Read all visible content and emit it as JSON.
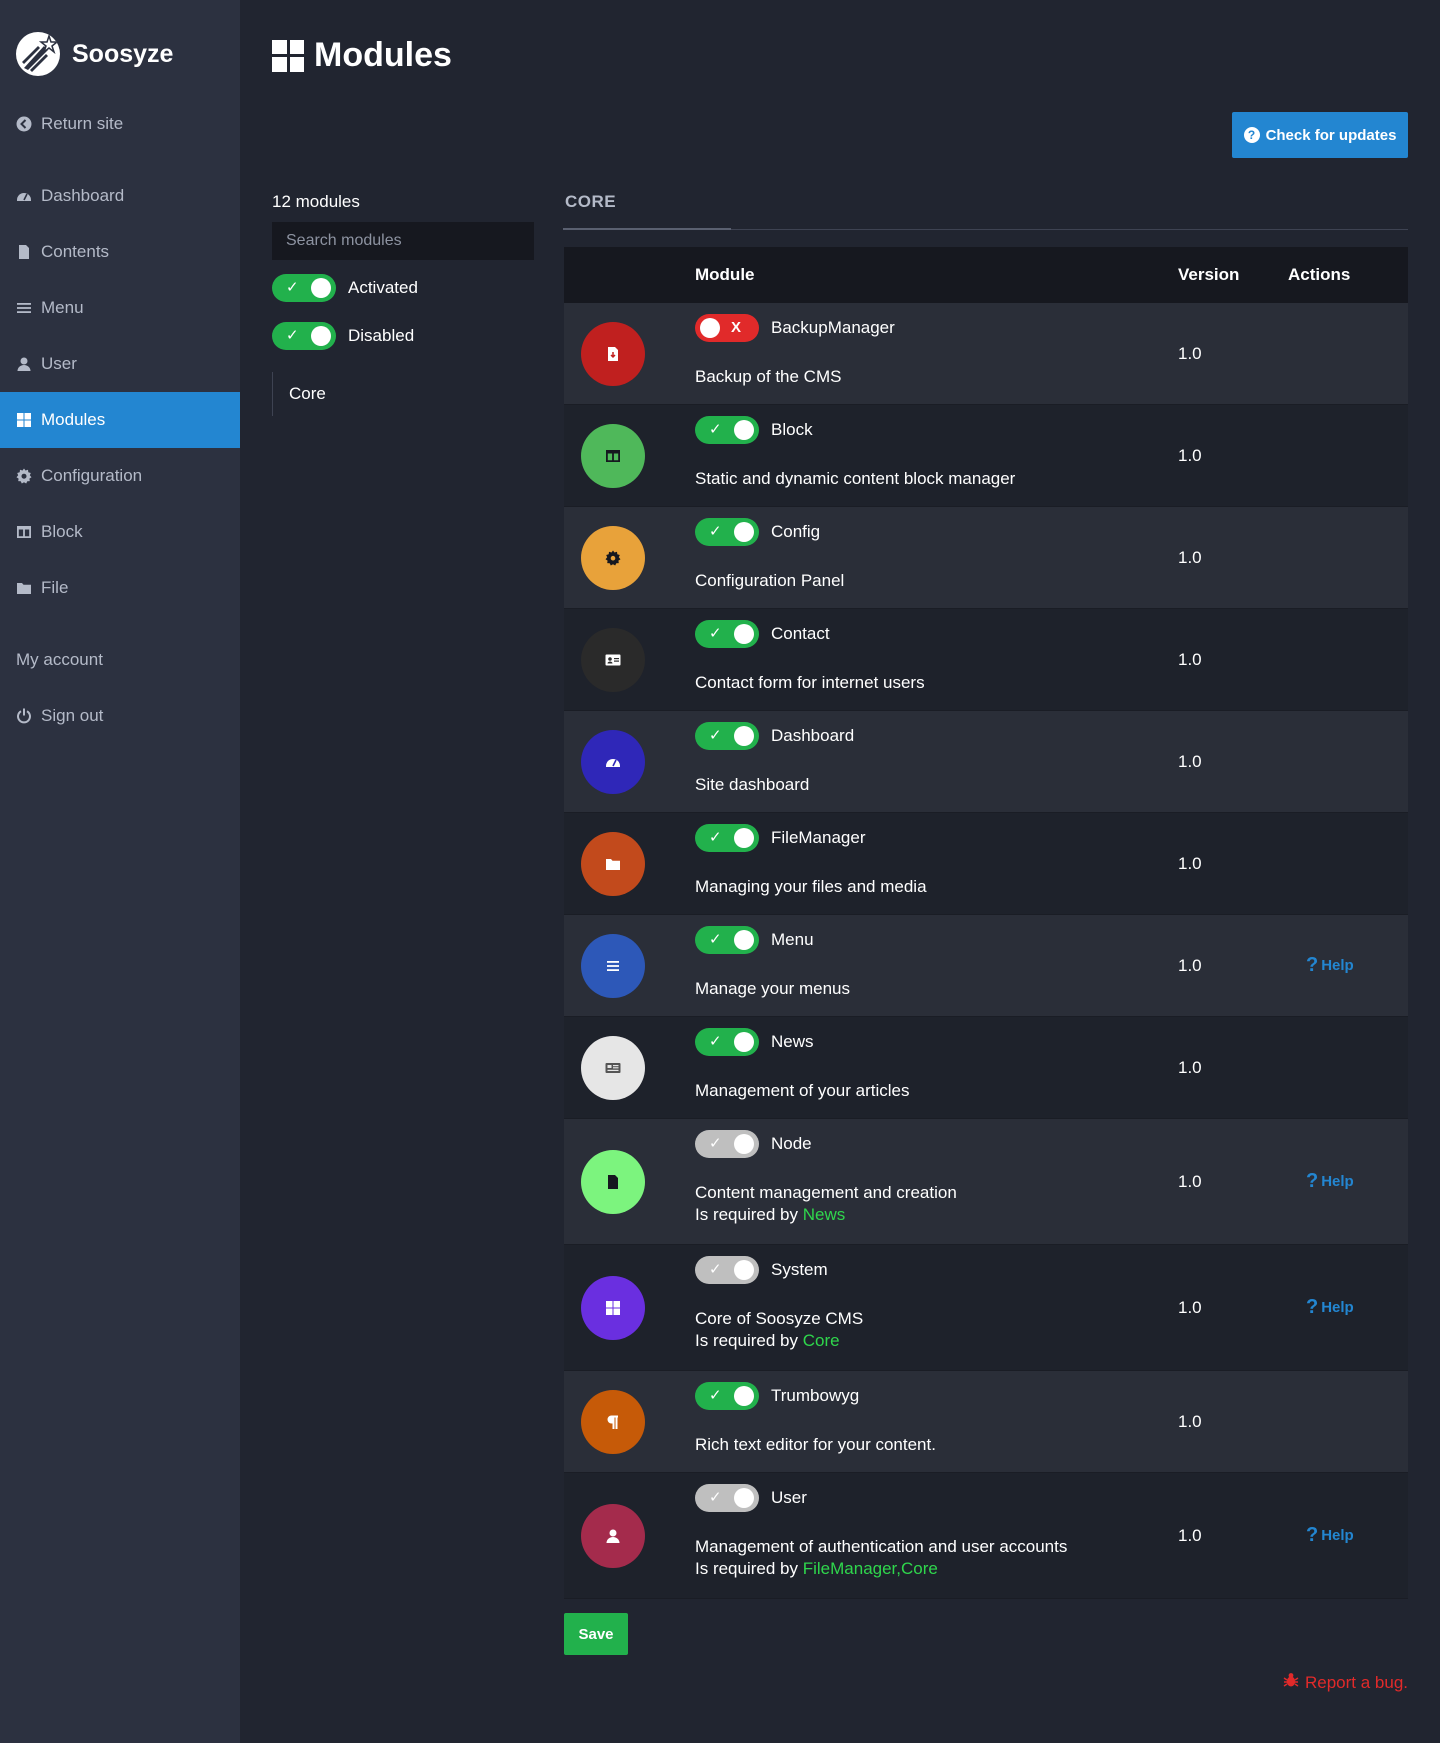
{
  "brand": {
    "name": "Soosyze"
  },
  "sidebar": {
    "items": [
      {
        "label": "Return site",
        "icon": "arrow-left-circle-icon"
      },
      {
        "label": "Dashboard",
        "icon": "dashboard-icon"
      },
      {
        "label": "Contents",
        "icon": "file-icon"
      },
      {
        "label": "Menu",
        "icon": "menu-icon"
      },
      {
        "label": "User",
        "icon": "user-icon"
      },
      {
        "label": "Modules",
        "icon": "modules-icon",
        "active": true
      },
      {
        "label": "Configuration",
        "icon": "gear-icon"
      },
      {
        "label": "Block",
        "icon": "block-icon"
      },
      {
        "label": "File",
        "icon": "folder-icon"
      },
      {
        "label": "My account"
      },
      {
        "label": "Sign out",
        "icon": "power-icon"
      }
    ]
  },
  "header": {
    "title": "Modules",
    "check_updates": "Check for updates"
  },
  "filters": {
    "count": "12 modules",
    "search_placeholder": "Search modules",
    "activated": "Activated",
    "disabled": "Disabled",
    "category": "Core",
    "toggle_on_mark": "✓",
    "toggle_off_mark": "X"
  },
  "tab": {
    "label": "CORE"
  },
  "table": {
    "headers": {
      "module": "Module",
      "version": "Version",
      "actions": "Actions"
    },
    "help_label": "Help",
    "help_mark": "?",
    "required_prefix": "Is required by",
    "rows": [
      {
        "name": "BackupManager",
        "desc": "Backup of the CMS",
        "version": "1.0",
        "state": "off",
        "color": "#c0201f",
        "icon": "backup-file-icon"
      },
      {
        "name": "Block",
        "desc": "Static and dynamic content block manager",
        "version": "1.0",
        "state": "on",
        "color": "#4fb85a",
        "icon": "block-icon"
      },
      {
        "name": "Config",
        "desc": "Configuration Panel",
        "version": "1.0",
        "state": "on",
        "color": "#e8a23a",
        "icon": "gear-icon"
      },
      {
        "name": "Contact",
        "desc": "Contact form for internet users",
        "version": "1.0",
        "state": "on",
        "color": "#2a2a2a",
        "icon": "contact-card-icon"
      },
      {
        "name": "Dashboard",
        "desc": "Site dashboard",
        "version": "1.0",
        "state": "on",
        "color": "#2f27b8",
        "icon": "dashboard-icon"
      },
      {
        "name": "FileManager",
        "desc": "Managing your files and media",
        "version": "1.0",
        "state": "on",
        "color": "#c24a1c",
        "icon": "folder-icon"
      },
      {
        "name": "Menu",
        "desc": "Manage your menus",
        "version": "1.0",
        "state": "on",
        "color": "#2d58b8",
        "icon": "menu-icon",
        "help": true
      },
      {
        "name": "News",
        "desc": "Management of your articles",
        "version": "1.0",
        "state": "on",
        "color": "#e6e6e6",
        "icon": "newspaper-icon"
      },
      {
        "name": "Node",
        "desc": "Content management and creation",
        "required": "News",
        "version": "1.0",
        "state": "grey",
        "color": "#7cf47e",
        "icon": "file-icon",
        "help": true
      },
      {
        "name": "System",
        "desc": "Core of Soosyze CMS",
        "required": "Core",
        "version": "1.0",
        "state": "grey",
        "color": "#6a2fe0",
        "icon": "modules-icon",
        "help": true
      },
      {
        "name": "Trumbowyg",
        "desc": "Rich text editor for your content.",
        "version": "1.0",
        "state": "on",
        "color": "#c65a08",
        "icon": "paragraph-icon"
      },
      {
        "name": "User",
        "desc": "Management of authentication and user accounts",
        "required": "FileManager,Core",
        "version": "1.0",
        "state": "grey",
        "color": "#a42b4c",
        "icon": "user-icon",
        "help": true
      }
    ]
  },
  "save_label": "Save",
  "report_bug": "Report a bug.",
  "colors": {
    "accent": "#2386d1",
    "success": "#22b14c",
    "danger": "#e12a2a"
  }
}
